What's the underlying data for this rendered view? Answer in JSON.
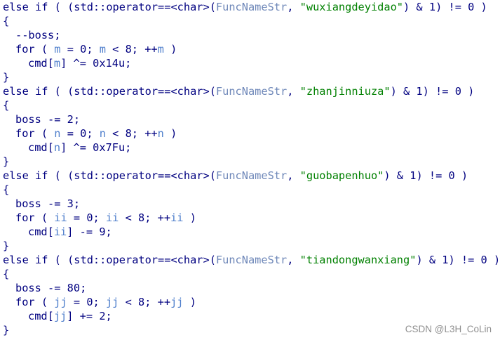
{
  "blocks": [
    {
      "kw_else_if": "else if ( (std::operator==<char>(",
      "func": "FuncNameStr",
      "sep": ", ",
      "str": "\"wuxiangdeyidao\"",
      "cond_tail": ") & 1) != 0 )",
      "open": "{",
      "boss_stmt": "--boss;",
      "for_head": "for ( ",
      "loop_var": "m",
      "init": " = 0; ",
      "cmp": " < 8; ++",
      "for_close": " )",
      "cmd_prefix": "cmd[",
      "cmd_suffix": "] ^= 0x14u;",
      "close": "}"
    },
    {
      "kw_else_if": "else if ( (std::operator==<char>(",
      "func": "FuncNameStr",
      "sep": ", ",
      "str": "\"zhanjinniuza\"",
      "cond_tail": ") & 1) != 0 )",
      "open": "{",
      "boss_stmt": "boss -= 2;",
      "for_head": "for ( ",
      "loop_var": "n",
      "init": " = 0; ",
      "cmp": " < 8; ++",
      "for_close": " )",
      "cmd_prefix": "cmd[",
      "cmd_suffix": "] ^= 0x7Fu;",
      "close": "}"
    },
    {
      "kw_else_if": "else if ( (std::operator==<char>(",
      "func": "FuncNameStr",
      "sep": ", ",
      "str": "\"guobapenhuo\"",
      "cond_tail": ") & 1) != 0 )",
      "open": "{",
      "boss_stmt": "boss -= 3;",
      "for_head": "for ( ",
      "loop_var": "ii",
      "init": " = 0; ",
      "cmp": " < 8; ++",
      "for_close": " )",
      "cmd_prefix": "cmd[",
      "cmd_suffix": "] -= 9;",
      "close": "}"
    },
    {
      "kw_else_if": "else if ( (std::operator==<char>(",
      "func": "FuncNameStr",
      "sep": ", ",
      "str": "\"tiandongwanxiang\"",
      "cond_tail": ") & 1) != 0 )",
      "open": "{",
      "boss_stmt": "boss -= 80;",
      "for_head": "for ( ",
      "loop_var": "jj",
      "init": " = 0; ",
      "cmp": " < 8; ++",
      "for_close": " )",
      "cmd_prefix": "cmd[",
      "cmd_suffix": "] += 2;",
      "close": "}"
    }
  ],
  "watermark": "CSDN @L3H_CoLin",
  "colors": {
    "code_text": "#000080",
    "identifier": "#6f88b9",
    "local_variable": "#4f7fcc",
    "string_literal": "#008000",
    "watermark": "#8f8f8f",
    "background": "#ffffff"
  }
}
